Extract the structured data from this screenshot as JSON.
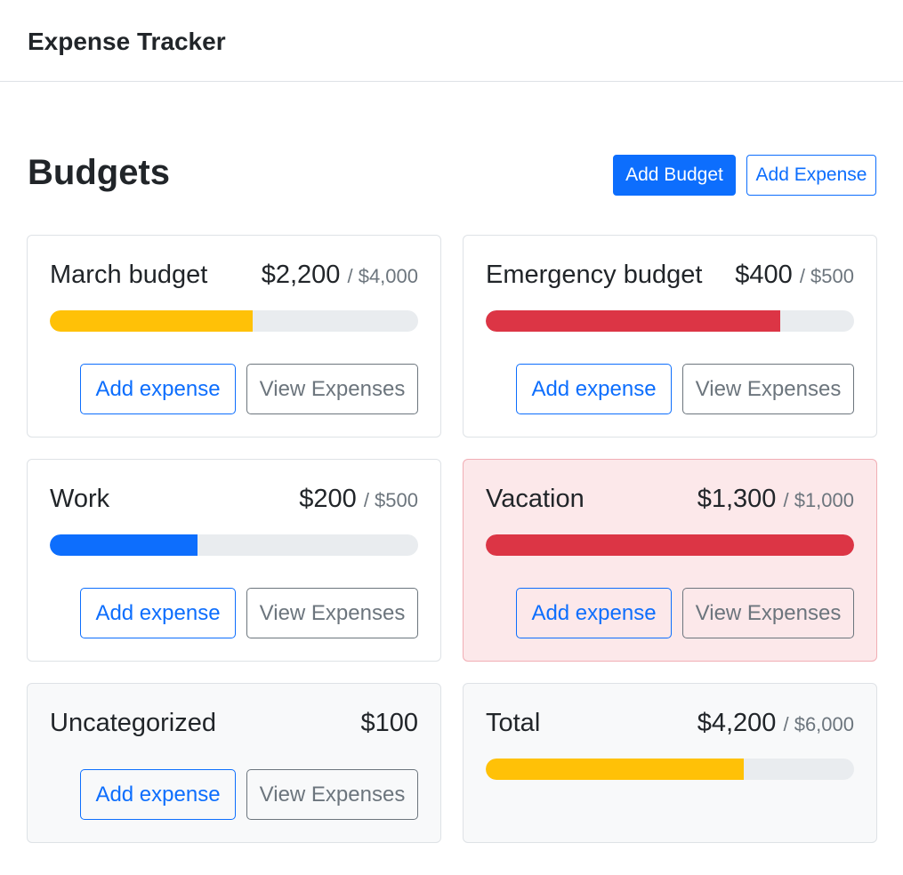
{
  "app": {
    "title": "Expense Tracker"
  },
  "page": {
    "title": "Budgets",
    "add_budget_label": "Add Budget",
    "add_expense_label": "Add Expense"
  },
  "colors": {
    "primary": "#0d6efd",
    "warning": "#ffc107",
    "danger": "#dc3545",
    "secondary": "#6c757d",
    "danger_bg": "#fce8ea"
  },
  "budgets": [
    {
      "name": "March budget",
      "amount": "$2,200",
      "max": "/ $4,000",
      "progress": 0.55,
      "variant": "warning",
      "add_label": "Add expense",
      "view_label": "View Expenses"
    },
    {
      "name": "Emergency budget",
      "amount": "$400",
      "max": "/ $500",
      "progress": 0.8,
      "variant": "danger",
      "add_label": "Add expense",
      "view_label": "View Expenses"
    },
    {
      "name": "Work",
      "amount": "$200",
      "max": "/ $500",
      "progress": 0.4,
      "variant": "primary",
      "add_label": "Add expense",
      "view_label": "View Expenses"
    },
    {
      "name": "Vacation",
      "amount": "$1,300",
      "max": "/ $1,000",
      "progress": 1.0,
      "variant": "danger",
      "over_budget": true,
      "add_label": "Add expense",
      "view_label": "View Expenses"
    },
    {
      "name": "Uncategorized",
      "amount": "$100",
      "add_label": "Add expense",
      "view_label": "View Expenses"
    },
    {
      "name": "Total",
      "amount": "$4,200",
      "max": "/ $6,000",
      "progress": 0.7,
      "variant": "warning"
    }
  ]
}
